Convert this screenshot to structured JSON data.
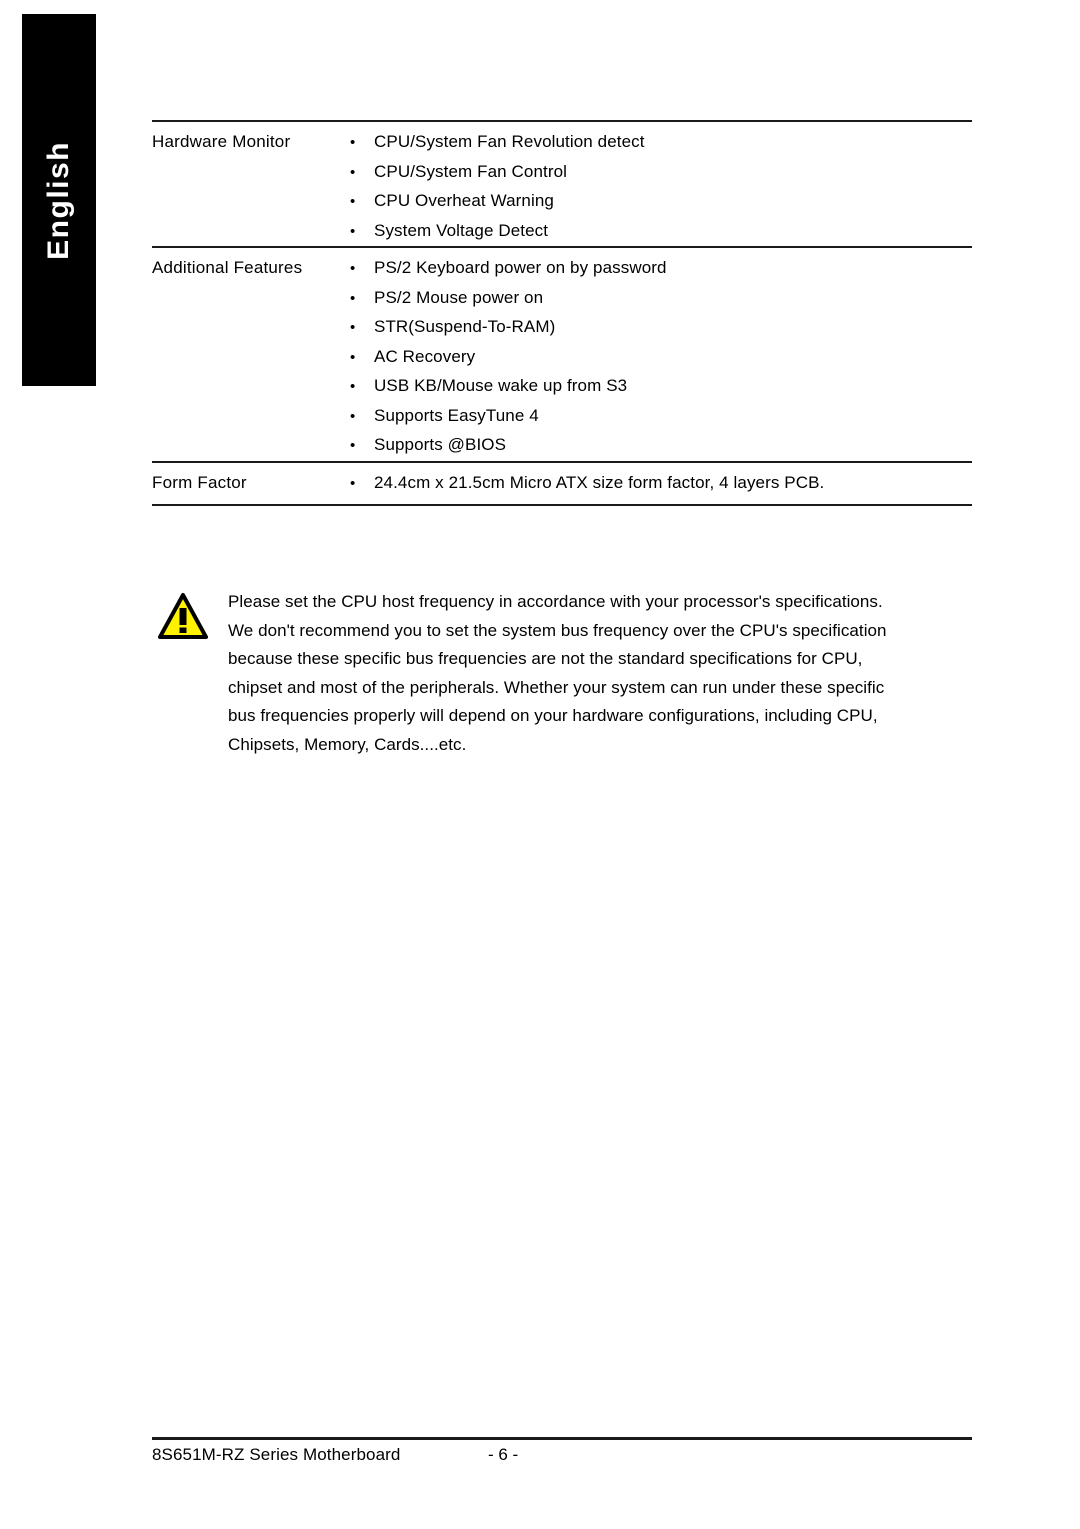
{
  "language_tab": {
    "label": "English"
  },
  "spec_table": {
    "sections": [
      {
        "label": "Hardware Monitor",
        "bullet": "•",
        "items": [
          "CPU/System Fan Revolution detect",
          "CPU/System Fan Control",
          "CPU Overheat Warning",
          "System Voltage Detect"
        ]
      },
      {
        "label": "Additional Features",
        "bullet": "•",
        "items": [
          "PS/2 Keyboard power on by password",
          "PS/2 Mouse power on",
          "STR(Suspend-To-RAM)",
          "AC Recovery",
          "USB KB/Mouse wake up from S3",
          "Supports EasyTune 4",
          "Supports @BIOS"
        ]
      },
      {
        "label": "Form Factor",
        "bullet": "•",
        "items": [
          "24.4cm x 21.5cm Micro ATX size form factor, 4 layers PCB."
        ]
      }
    ]
  },
  "note": {
    "icon": "warning-triangle-icon",
    "icon_fill_color": "#FFF200",
    "icon_stroke_color": "#000000",
    "lines": [
      "Please set the CPU host frequency in accordance with your processor's specifications.",
      "We don't recommend you to set the system bus frequency over the CPU's specification",
      "because these specific bus frequencies are not the standard specifications for CPU,",
      "chipset and most of the peripherals. Whether your system can run under  these specific",
      "bus frequencies properly will depend on your hardware configurations, including CPU,",
      "Chipsets, Memory, Cards....etc."
    ]
  },
  "footer": {
    "title": "8S651M-RZ Series Motherboard",
    "page_number": "- 6 -"
  }
}
